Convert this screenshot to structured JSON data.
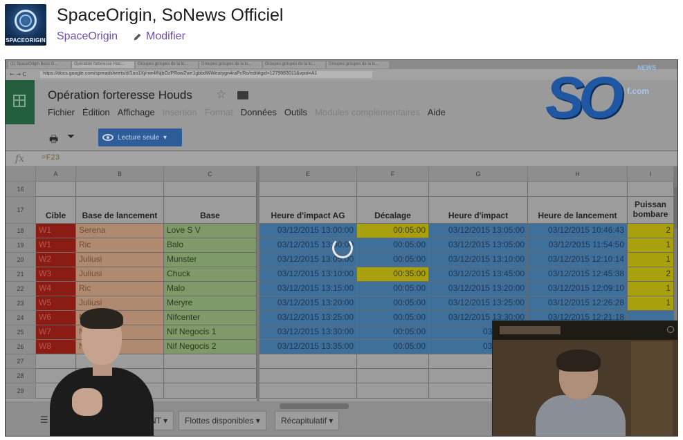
{
  "page": {
    "title": "SpaceOrigin, SoNews Officiel",
    "channel_link": "SpaceOrigin",
    "edit_link": "Modifier",
    "avatar_label": "SPACEORIGIN"
  },
  "browser": {
    "url": "https://docs.google.com/spreadsheets/d/1oo1Xj/rxe4fNjbOzPRowZwe1gbbdWWeatygn4raPcRo/edit#gid=1279983011&vpid=A1",
    "tabs": [
      "(1) SpaceOrigin Boss G...",
      "Opération forteresse Hou...",
      "Groupes groupes de la lu...",
      "Groupes groupes de la lu...",
      "Groupes groupes de la lu...",
      "Groupes groupes de la lu..."
    ]
  },
  "sheets": {
    "doc_title": "Opération forteresse Houds",
    "menu": [
      {
        "label": "Fichier",
        "enabled": true
      },
      {
        "label": "Édition",
        "enabled": true
      },
      {
        "label": "Affichage",
        "enabled": true
      },
      {
        "label": "Insertion",
        "enabled": false
      },
      {
        "label": "Format",
        "enabled": false
      },
      {
        "label": "Données",
        "enabled": true
      },
      {
        "label": "Outils",
        "enabled": true
      },
      {
        "label": "Modules complémentaires",
        "enabled": false
      },
      {
        "label": "Aide",
        "enabled": true
      }
    ],
    "readonly_label": "Lecture seule",
    "formula": "=F23",
    "fx_label": "fx",
    "left_cols": [
      "A",
      "B",
      "C"
    ],
    "right_cols": [
      "E",
      "F",
      "G",
      "H",
      "I"
    ],
    "row_numbers": [
      "16",
      "17",
      "18",
      "19",
      "20",
      "21",
      "22",
      "23",
      "24",
      "25",
      "26",
      "27",
      "28",
      "29"
    ],
    "headers": {
      "cible": "Cible",
      "base_lancement": "Base de lancement",
      "base": "Base",
      "impact_ag": "Heure d'impact AG",
      "decalage": "Décalage",
      "impact": "Heure d'impact",
      "lancement": "Heure de lancement",
      "puissance": "Puissan bombare"
    },
    "rows": [
      {
        "cible": "W1",
        "base_lancement": "Serena",
        "base": "Love S V",
        "impact_ag": "03/12/2015 13:00:00",
        "decalage": "00:05:00",
        "impact": "03/12/2015 13:05:00",
        "lancement": "03/12/2015 10:46:43",
        "puissance": "2"
      },
      {
        "cible": "W1",
        "base_lancement": "Ric",
        "base": "Balo",
        "impact_ag": "03/12/2015 13:00:00",
        "decalage": "00:05:00",
        "impact": "03/12/2015 13:05:00",
        "lancement": "03/12/2015 11:54:50",
        "puissance": "1"
      },
      {
        "cible": "W2",
        "base_lancement": "Juliusi",
        "base": "Munster",
        "impact_ag": "03/12/2015 13:05:00",
        "decalage": "00:05:00",
        "impact": "03/12/2015 13:10:00",
        "lancement": "03/12/2015 12:10:14",
        "puissance": "1"
      },
      {
        "cible": "W3",
        "base_lancement": "Juliusi",
        "base": "Chuck",
        "impact_ag": "03/12/2015 13:10:00",
        "decalage": "00:35:00",
        "impact": "03/12/2015 13:45:00",
        "lancement": "03/12/2015 12:45:38",
        "puissance": "2"
      },
      {
        "cible": "W4",
        "base_lancement": "Ric",
        "base": "Malo",
        "impact_ag": "03/12/2015 13:15:00",
        "decalage": "00:05:00",
        "impact": "03/12/2015 13:20:00",
        "lancement": "03/12/2015 12:09:10",
        "puissance": "1"
      },
      {
        "cible": "W5",
        "base_lancement": "Juliusi",
        "base": "Meryre",
        "impact_ag": "03/12/2015 13:20:00",
        "decalage": "00:05:00",
        "impact": "03/12/2015 13:25:00",
        "lancement": "03/12/2015 12:26:28",
        "puissance": "1"
      },
      {
        "cible": "W6",
        "base_lancement": "N",
        "base": "Nifcenter",
        "impact_ag": "03/12/2015 13:25:00",
        "decalage": "00:05:00",
        "impact": "03/12/2015 13:30:00",
        "lancement": "03/12/2015 12:21:18",
        "puissance": ""
      },
      {
        "cible": "W7",
        "base_lancement": "N",
        "base": "Nif Negocis 1",
        "impact_ag": "03/12/2015 13:30:00",
        "decalage": "00:05:00",
        "impact": "03/12/2015",
        "lancement": "",
        "puissance": ""
      },
      {
        "cible": "W8",
        "base_lancement": "N",
        "base": "Nif Negocis 2",
        "impact_ag": "03/12/2015 13:35:00",
        "decalage": "00:05:00",
        "impact": "03/12/2015",
        "lancement": "",
        "puissance": ""
      }
    ],
    "sheet_tabs": [
      "ENT",
      "Flottes disponibles",
      "Récapitulatif"
    ]
  },
  "logo": {
    "letters": "SO",
    "suffix": "f.com",
    "badge": "NEWS"
  },
  "colors": {
    "link": "#6a4fb0",
    "readonly_button": "#2f5d9a",
    "cible_red": "#8a1c14",
    "salmon": "#b08a70",
    "green": "#7f9a68",
    "blue": "#3f6f9b",
    "yellow": "#a8a00e"
  }
}
